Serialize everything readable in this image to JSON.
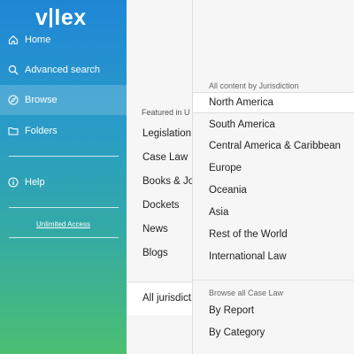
{
  "brand": {
    "logo_left": "v",
    "logo_right": "lex"
  },
  "sidebar": {
    "items": [
      {
        "label": "Home",
        "icon": "home-icon"
      },
      {
        "label": "Advanced search",
        "icon": "search-icon"
      },
      {
        "label": "Browse",
        "icon": "compass-icon",
        "active": true
      },
      {
        "label": "Folders",
        "icon": "folder-icon"
      },
      {
        "label": "Help",
        "icon": "info-icon"
      }
    ],
    "unlimited_access": "Unlimited Access"
  },
  "middle": {
    "featured_heading": "Featured in U",
    "items": [
      "Legislation",
      "Case Law",
      "Books & Jo",
      "Dockets",
      "News",
      "Blogs"
    ],
    "all_jurisdictions": "All jurisdict"
  },
  "right": {
    "jurisdiction_heading": "All content by Jurisdiction",
    "jurisdictions": [
      "North America",
      "South America",
      "Central America & Caribbean",
      "Europe",
      "Oceania",
      "Asia",
      "Rest of the World",
      "International Law"
    ],
    "caselaw_heading": "Browse all Case Law",
    "caselaw_items": [
      "By Report",
      "By Category"
    ]
  },
  "colors": {
    "sidebar_top": "#1f86d6",
    "sidebar_bottom": "#4cbf72",
    "highlight": "#ffffff"
  }
}
